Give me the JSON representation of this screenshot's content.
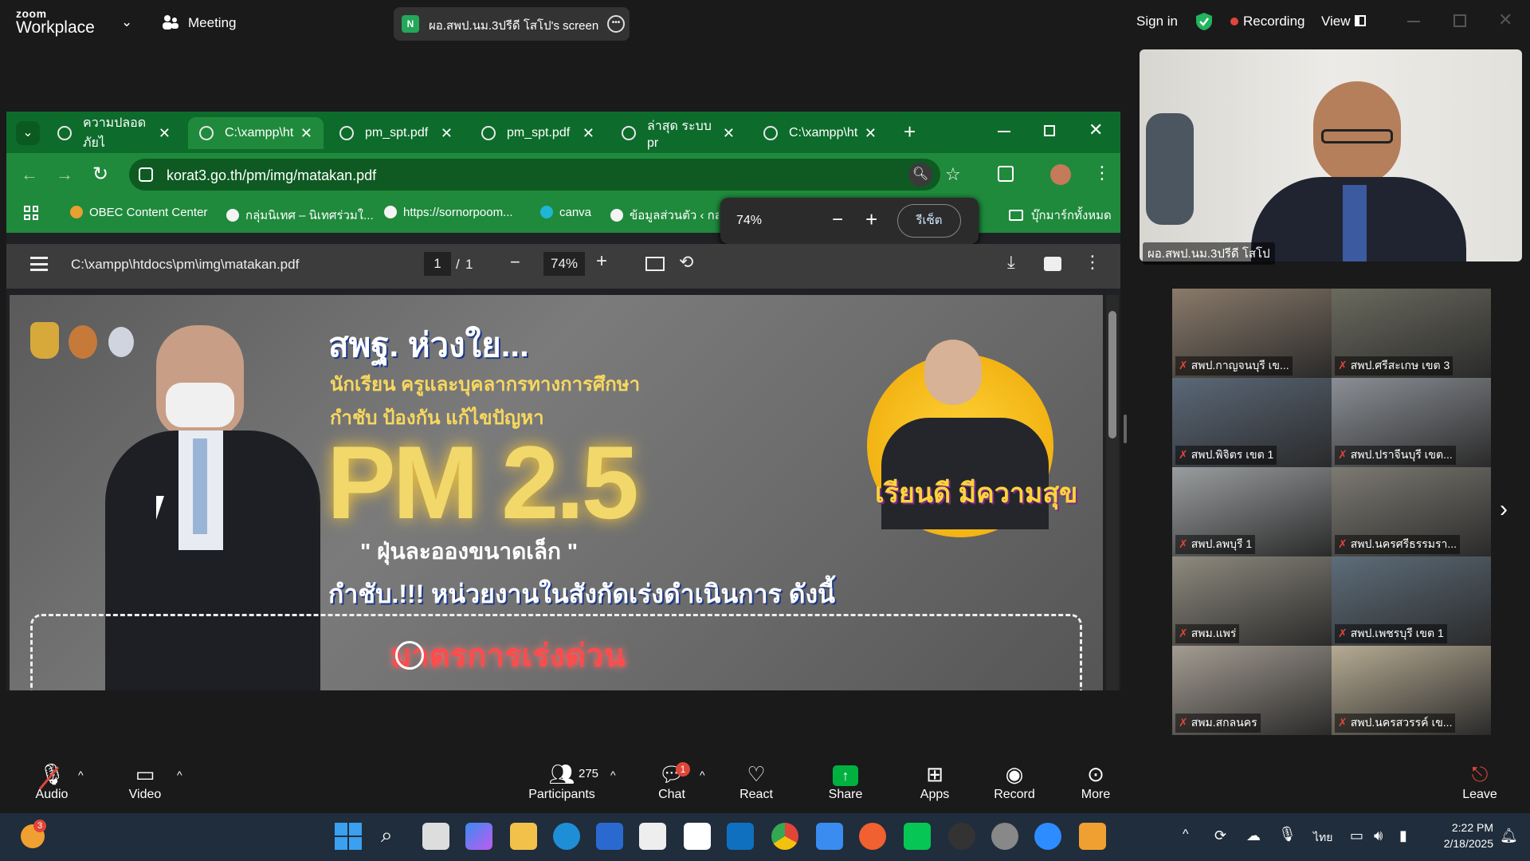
{
  "zoom": {
    "logo_top": "zoom",
    "logo_bottom": "Workplace",
    "meeting_label": "Meeting",
    "share_chip_initial": "N",
    "share_chip_text": "ผอ.สพป.นม.3ปรีดี โสโป's screen",
    "sign_in": "Sign in",
    "recording": "Recording",
    "view": "View"
  },
  "browser": {
    "tabs": [
      {
        "label": "ความปลอดภัยไ"
      },
      {
        "label": "C:\\xampp\\ht"
      },
      {
        "label": "pm_spt.pdf"
      },
      {
        "label": "pm_spt.pdf"
      },
      {
        "label": "ล่าสุด ระบบ pr"
      },
      {
        "label": "C:\\xampp\\ht"
      }
    ],
    "url": "korat3.go.th/pm/img/matakan.pdf",
    "bookmarks": [
      "OBEC Content Center",
      "กลุ่มนิเทศ – นิเทศร่วมใ...",
      "https://sornorpoom...",
      "canva",
      "ข้อมูลส่วนตัว ‹ กลุ่"
    ],
    "all_bookmarks": "บุ๊กมาร์กทั้งหมด",
    "zoom_popup": {
      "value": "74%",
      "reset": "รีเซ็ต"
    }
  },
  "pdf": {
    "path": "C:\\xampp\\htdocs\\pm\\img\\matakan.pdf",
    "page_current": "1",
    "page_sep": "/",
    "page_total": "1",
    "zoom": "74%",
    "content": {
      "headline": "สพฐ. ห่วงใย...",
      "line1": "นักเรียน ครูและบุคลากรทางการศึกษา",
      "line2": "กำชับ ป้องกัน แก้ไขปัญหา",
      "pm": "PM 2.5",
      "dust": "\" ฝุ่นละอองขนาดเล็ก \"",
      "order": "กำชับ.!!!  หน่วยงานในสังกัดเร่งดำเนินการ ดังนี้",
      "badge": "เรียนดี มีความสุข",
      "urgent": "มาตรการเร่งด่วน"
    }
  },
  "self_video": {
    "name": "ผอ.สพป.นม.3ปรีดี โสโป"
  },
  "gallery": [
    {
      "name": "สพป.กาญจนบุรี เข...",
      "bg": "#8a7a6a"
    },
    {
      "name": "สพป.ศรีสะเกษ เขต 3",
      "bg": "#6b6a5e"
    },
    {
      "name": "สพป.พิจิตร เขต 1",
      "bg": "#5b6878"
    },
    {
      "name": "สพป.ปราจีนบุรี เขต...",
      "bg": "#8b8f95"
    },
    {
      "name": "สพป.ลพบุรี 1",
      "bg": "#9a9d9f"
    },
    {
      "name": "สพป.นครศรีธรรมรา...",
      "bg": "#7d7a72"
    },
    {
      "name": "สพม.แพร่",
      "bg": "#8e8a7e"
    },
    {
      "name": "สพป.เพชรบุรี เขต 1",
      "bg": "#5d6d7a"
    },
    {
      "name": "สพม.สกลนคร",
      "bg": "#a49c92"
    },
    {
      "name": "สพป.นครสวรรค์ เข...",
      "bg": "#b6ab93"
    }
  ],
  "toolbar": {
    "audio": "Audio",
    "video": "Video",
    "participants": "Participants",
    "participants_count": "275",
    "chat": "Chat",
    "chat_badge": "1",
    "react": "React",
    "share": "Share",
    "apps": "Apps",
    "record": "Record",
    "more": "More",
    "leave": "Leave"
  },
  "taskbar": {
    "weather_badge": "3",
    "lang": "ไทย",
    "time": "2:22 PM",
    "date": "2/18/2025"
  },
  "colors": {
    "accent_green": "#1f8a3c",
    "share_green": "#00b140",
    "record_red": "#e0453a"
  }
}
